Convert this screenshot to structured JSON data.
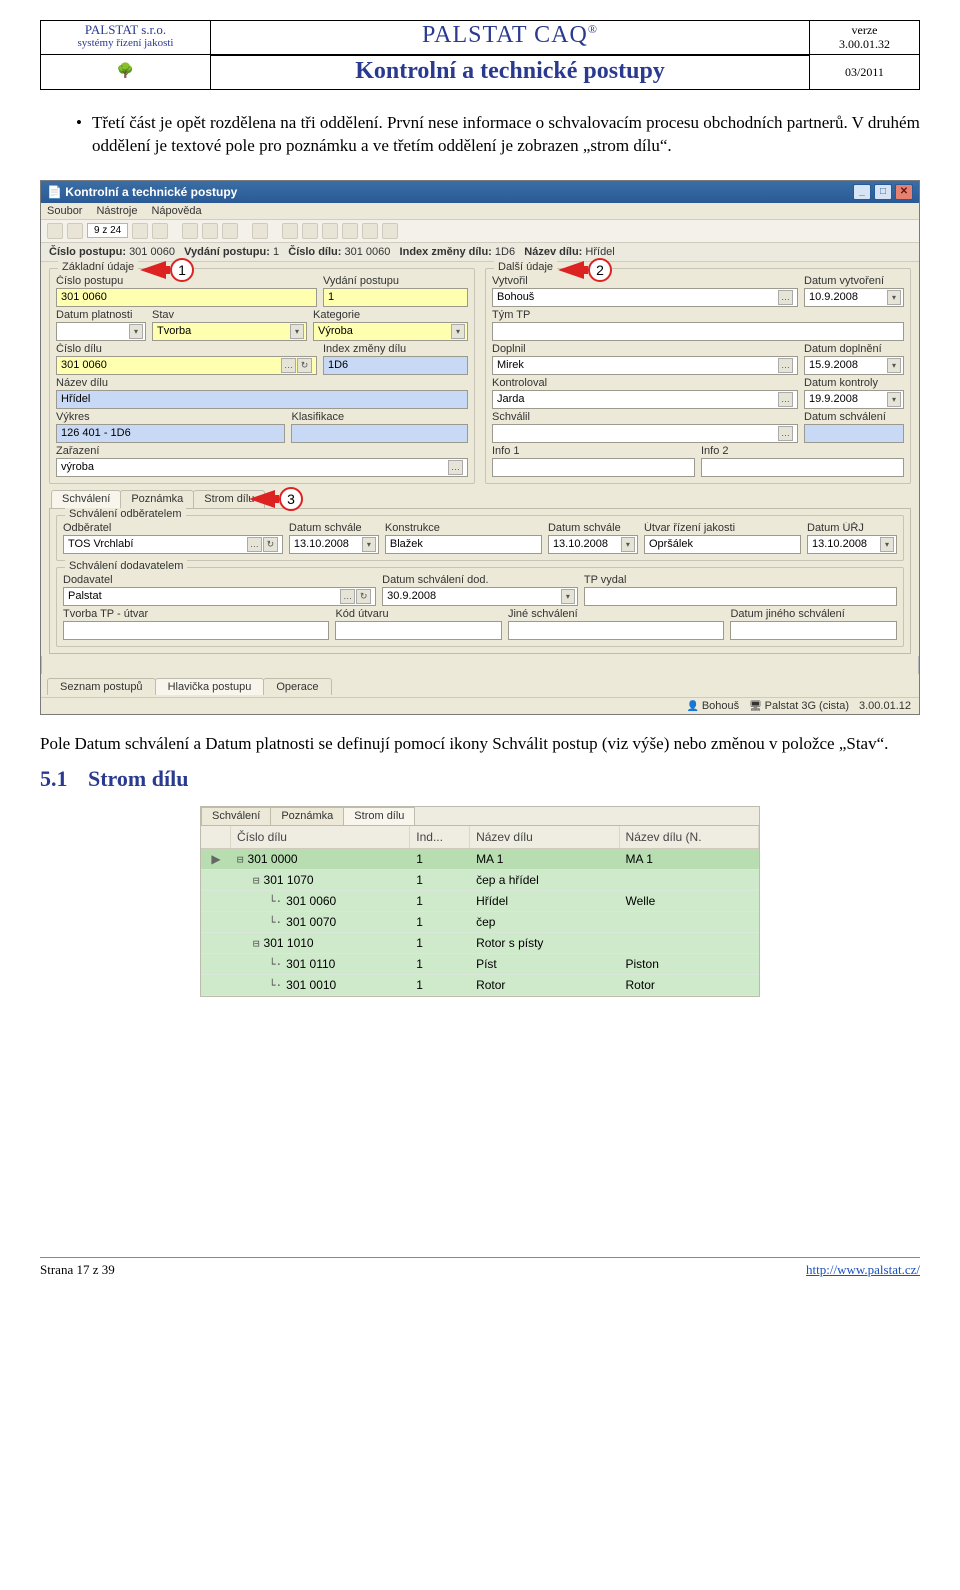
{
  "header": {
    "company": "PALSTAT s.r.o.",
    "company_sub": "systémy řízení jakosti",
    "title1": "PALSTAT CAQ",
    "reg": "®",
    "title2": "Kontrolní a technické postupy",
    "verze_label": "verze",
    "verze": "3.00.01.32",
    "issue": "03/2011"
  },
  "body": {
    "para1": "Třetí část je opět rozdělena na tři oddělení. První nese informace o schvalovacím procesu obchodních partnerů. V druhém oddělení je textové pole pro poznámku a ve třetím oddělení je zobrazen „strom dílu“.",
    "para2": "Pole Datum schválení a Datum platnosti se definují pomocí ikony Schválit postup (viz výše) nebo změnou v položce „Stav“."
  },
  "section": {
    "num": "5.1",
    "title": "Strom dílu"
  },
  "app": {
    "title": "Kontrolní a technické postupy",
    "menu": [
      "Soubor",
      "Nástroje",
      "Nápověda"
    ],
    "nav_text": "9 z 24",
    "infobar": {
      "l1": "Číslo postupu:",
      "v1": "301 0060",
      "l2": "Vydání postupu:",
      "v2": "1",
      "l3": "Číslo dílu:",
      "v3": "301 0060",
      "l4": "Index změny dílu:",
      "v4": "1D6",
      "l5": "Název dílu:",
      "v5": "Hřídel"
    },
    "zaklad": {
      "legend": "Základní údaje",
      "cislo_postupu_l": "Číslo postupu",
      "cislo_postupu": "301 0060",
      "vydani_l": "Vydání postupu",
      "vydani": "1",
      "datum_platnosti_l": "Datum platnosti",
      "datum_platnosti": "",
      "stav_l": "Stav",
      "stav": "Tvorba",
      "kategorie_l": "Kategorie",
      "kategorie": "Výroba",
      "cislo_dilu_l": "Číslo dílu",
      "cislo_dilu": "301 0060",
      "index_l": "Index změny dílu",
      "index": "1D6",
      "nazev_l": "Název dílu",
      "nazev": "Hřídel",
      "vykres_l": "Výkres",
      "vykres": "126 401 - 1D6",
      "klasifikace_l": "Klasifikace",
      "klasifikace": "",
      "zarazeni_l": "Zařazení",
      "zarazeni": "výroba"
    },
    "dalsi": {
      "legend": "Další údaje",
      "vytvoril_l": "Vytvořil",
      "vytvoril": "Bohouš",
      "datum_vytv_l": "Datum vytvoření",
      "datum_vytv": "10.9.2008",
      "tym_l": "Tým TP",
      "tym": "",
      "doplnil_l": "Doplnil",
      "doplnil": "Mirek",
      "datum_dopl_l": "Datum doplnění",
      "datum_dopl": "15.9.2008",
      "kontroloval_l": "Kontroloval",
      "kontroloval": "Jarda",
      "datum_kontr_l": "Datum kontroly",
      "datum_kontr": "19.9.2008",
      "schvalil_l": "Schválil",
      "schvalil": "",
      "datum_schval_l": "Datum schválení",
      "datum_schval": "",
      "info1_l": "Info 1",
      "info1": "",
      "info2_l": "Info 2",
      "info2": ""
    },
    "tabs_mid": [
      "Schválení",
      "Poznámka",
      "Strom dílu"
    ],
    "schvaleni": {
      "odb_legend": "Schválení odběratelem",
      "odberatel_l": "Odběratel",
      "odberatel": "TOS Vrchlabí",
      "datum_schvale_l": "Datum schvále",
      "datum_schvale": "13.10.2008",
      "konstrukce_l": "Konstrukce",
      "konstrukce": "Blažek",
      "datum_schvale2_l": "Datum schvále",
      "datum_schvale2": "13.10.2008",
      "utvar_l": "Útvar řízení jakosti",
      "utvar": "Opršálek",
      "datum_urj_l": "Datum ÚŘJ",
      "datum_urj": "13.10.2008",
      "dod_legend": "Schválení dodavatelem",
      "dodavatel_l": "Dodavatel",
      "dodavatel": "Palstat",
      "datum_dod_l": "Datum schválení dod.",
      "datum_dod": "30.9.2008",
      "tpvydal_l": "TP vydal",
      "tpvydal": "",
      "tvorba_l": "Tvorba TP - útvar",
      "tvorba": "",
      "kod_utvaru_l": "Kód útvaru",
      "kod_utvaru": "",
      "jine_l": "Jiné schválení",
      "jine": "",
      "datum_jine_l": "Datum jiného schválení",
      "datum_jine": ""
    },
    "bottom_tabs": [
      "Seznam postupů",
      "Hlavička postupu",
      "Operace"
    ],
    "status": {
      "user": "Bohouš",
      "server": "Palstat 3G (cista)",
      "ver": "3.00.01.12"
    }
  },
  "tree": {
    "tabs": [
      "Schválení",
      "Poznámka",
      "Strom dílu"
    ],
    "headers": [
      "",
      "Číslo dílu",
      "Ind...",
      "Název dílu",
      "Název dílu (N."
    ],
    "rows": [
      {
        "sel": true,
        "indent": 0,
        "glyph": "⊟",
        "cislo": "301 0000",
        "ind": "1",
        "nazev": "MA 1",
        "nazev_n": "MA 1"
      },
      {
        "indent": 1,
        "glyph": "⊟",
        "cislo": "301 1070",
        "ind": "1",
        "nazev": "čep a hřídel",
        "nazev_n": ""
      },
      {
        "indent": 2,
        "glyph": "·",
        "cislo": "301 0060",
        "ind": "1",
        "nazev": "Hřídel",
        "nazev_n": "Welle"
      },
      {
        "indent": 2,
        "glyph": "·",
        "cislo": "301 0070",
        "ind": "1",
        "nazev": "čep",
        "nazev_n": ""
      },
      {
        "indent": 1,
        "glyph": "⊟",
        "cislo": "301 1010",
        "ind": "1",
        "nazev": "Rotor s písty",
        "nazev_n": ""
      },
      {
        "indent": 2,
        "glyph": "·",
        "cislo": "301 0110",
        "ind": "1",
        "nazev": "Píst",
        "nazev_n": "Piston"
      },
      {
        "indent": 2,
        "glyph": "·",
        "cislo": "301 0010",
        "ind": "1",
        "nazev": "Rotor",
        "nazev_n": "Rotor"
      }
    ]
  },
  "footer": {
    "page": "Strana 17 z 39",
    "url": "http://www.palstat.cz/"
  }
}
